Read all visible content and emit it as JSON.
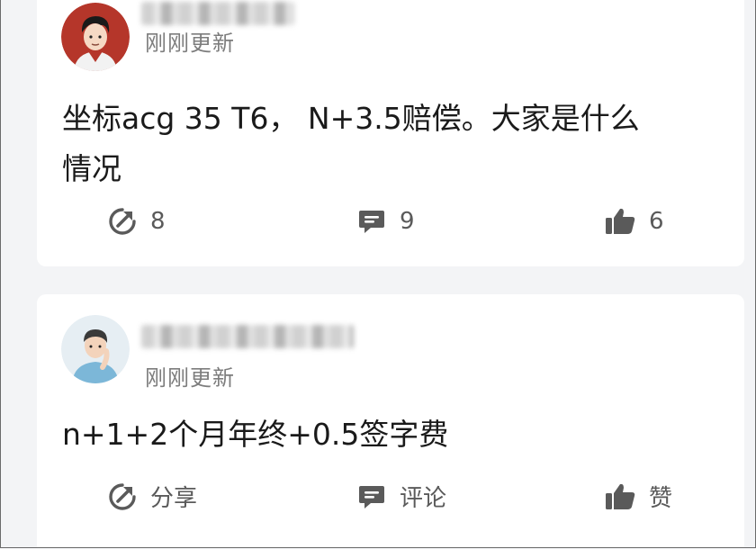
{
  "posts": [
    {
      "timestamp": "刚刚更新",
      "text_line1": "坐标acg 35 T6， N+3.5赔偿。大家是什么",
      "text_line2": "情况",
      "share_label": "8",
      "comment_label": "9",
      "like_label": "6"
    },
    {
      "timestamp": "刚刚更新",
      "text_line1": "n+1+2个月年终+0.5签字费",
      "text_line2": "",
      "share_label": "分享",
      "comment_label": "评论",
      "like_label": "赞"
    }
  ],
  "colors": {
    "background": "#f3f4f6",
    "card": "#ffffff",
    "text": "#1a1a1a",
    "muted": "#7d7d7d",
    "icon": "#5a5a5a"
  },
  "icons": [
    "share-icon",
    "comment-icon",
    "like-icon"
  ]
}
